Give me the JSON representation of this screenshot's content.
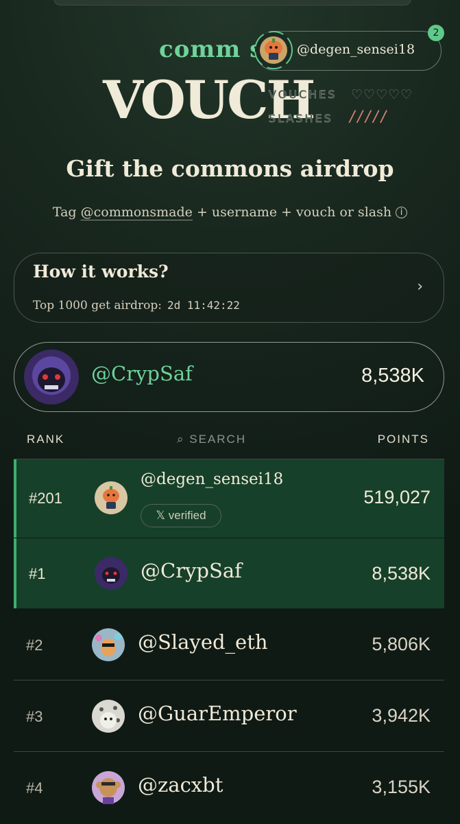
{
  "brand": {
    "commons": "comm  s",
    "vouch": "VOUCH"
  },
  "user": {
    "handle": "@degen_sensei18",
    "notifications": "2"
  },
  "counters": {
    "vouches_label": "VOUCHES",
    "slashes_label": "SLASHES",
    "hearts": "♡♡♡♡♡",
    "slashes_marks": "/////"
  },
  "headline": "Gift the commons airdrop",
  "instructions": {
    "prefix": "Tag ",
    "handle": "@commonsmade",
    "suffix": " + username + vouch or slash",
    "info_icon": "i"
  },
  "how_it_works": {
    "title": "How it works?",
    "subtitle": "Top 1000 get airdrop:",
    "countdown": "2d 11:42:22",
    "chevron": "›"
  },
  "top_user": {
    "handle": "@CrypSaf",
    "points": "8,538K"
  },
  "leaderboard": {
    "headers": {
      "rank": "RANK",
      "search_icon": "⌕",
      "search": "SEARCH",
      "points": "POINTS"
    },
    "me": {
      "rank": "#201",
      "handle": "@degen_sensei18",
      "badge": "𝕏 verified",
      "points": "519,027"
    },
    "rows": [
      {
        "rank": "#1",
        "handle": "@CrypSaf",
        "points": "8,538K"
      },
      {
        "rank": "#2",
        "handle": "@Slayed_eth",
        "points": "5,806K"
      },
      {
        "rank": "#3",
        "handle": "@GuarEmperor",
        "points": "3,942K"
      },
      {
        "rank": "#4",
        "handle": "@zacxbt",
        "points": "3,155K"
      }
    ]
  },
  "colors": {
    "accent": "#6fd39a",
    "highlight_row": "#16402a",
    "background": "#14201a",
    "slash_red": "#d9837a"
  }
}
